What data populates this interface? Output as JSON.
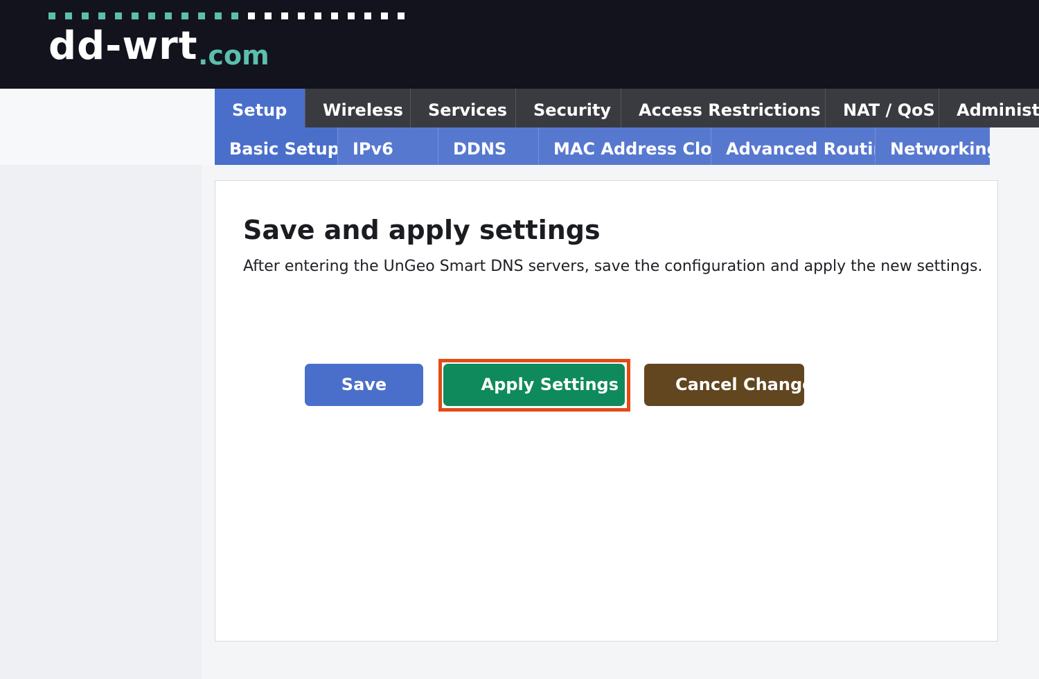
{
  "header": {
    "logo_main": "dd-wrt",
    "logo_tld": ".com",
    "dot_colors": [
      "#5bbfae",
      "#ffffff"
    ]
  },
  "nav": {
    "main_tabs": [
      {
        "label": "Setup",
        "active": true
      },
      {
        "label": "Wireless",
        "active": false
      },
      {
        "label": "Services",
        "active": false
      },
      {
        "label": "Security",
        "active": false
      },
      {
        "label": "Access Restrictions",
        "active": false
      },
      {
        "label": "NAT / QoS",
        "active": false
      },
      {
        "label": "Administration",
        "active": false
      }
    ],
    "sub_tabs": [
      {
        "label": "Basic Setup",
        "active": true
      },
      {
        "label": "IPv6",
        "active": false
      },
      {
        "label": "DDNS",
        "active": false
      },
      {
        "label": "MAC Address Clone",
        "active": false
      },
      {
        "label": "Advanced Routing",
        "active": false
      },
      {
        "label": "Networking",
        "active": false
      }
    ]
  },
  "content": {
    "title": "Save and apply settings",
    "description": "After entering the UnGeo Smart DNS servers, save the configuration and apply the new settings."
  },
  "buttons": {
    "save_label": "Save",
    "apply_label": "Apply Settings",
    "cancel_label": "Cancel Changes"
  },
  "colors": {
    "header_bg": "#13131d",
    "accent_blue": "#4a6fcb",
    "apply_green": "#0f8a5c",
    "cancel_brown": "#62461f",
    "highlight_orange": "#e24b16"
  }
}
